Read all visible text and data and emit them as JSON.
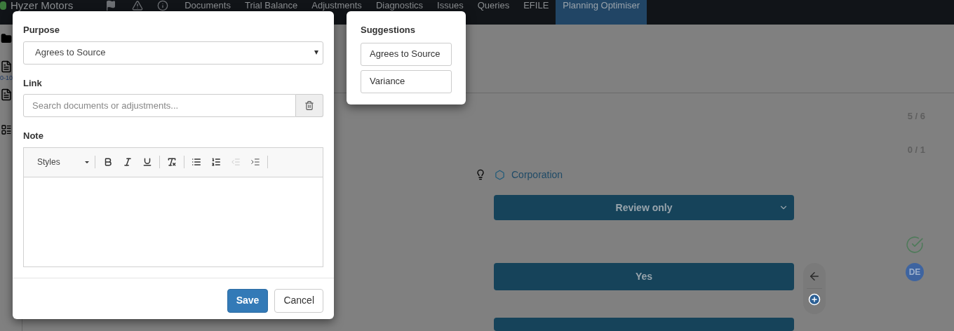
{
  "app": {
    "name": "Hyzer Motors"
  },
  "nav": [
    {
      "label": "Documents",
      "selected": false
    },
    {
      "label": "Trial Balance",
      "selected": false
    },
    {
      "label": "Adjustments",
      "selected": false
    },
    {
      "label": "Diagnostics",
      "selected": false
    },
    {
      "label": "Issues",
      "selected": false
    },
    {
      "label": "Queries",
      "selected": false
    },
    {
      "label": "EFILE",
      "selected": false
    },
    {
      "label": "Planning Optimiser",
      "selected": true
    }
  ],
  "sidebar": {
    "doc_label": "0-10"
  },
  "content": {
    "counts": [
      "5 / 6",
      "0 / 1"
    ],
    "entity": "Corporation",
    "review_select": "Review only",
    "answer_button": "Yes",
    "avatar": "DE",
    "reviewed": true
  },
  "dialog": {
    "purpose": {
      "label": "Purpose",
      "value": "Agrees to Source"
    },
    "link": {
      "label": "Link",
      "placeholder": "Search documents or adjustments..."
    },
    "note": {
      "label": "Note",
      "styles": "Styles",
      "toolbar": [
        {
          "kind": "bold",
          "disabled": false
        },
        {
          "kind": "italic",
          "disabled": false
        },
        {
          "kind": "underline",
          "disabled": false
        },
        {
          "kind": "clear-format",
          "disabled": false
        },
        {
          "kind": "bulleted-list",
          "disabled": false
        },
        {
          "kind": "numbered-list",
          "disabled": false
        },
        {
          "kind": "outdent",
          "disabled": true
        },
        {
          "kind": "indent",
          "disabled": false
        }
      ]
    },
    "buttons": [
      "Save",
      "Cancel"
    ]
  },
  "suggestions": {
    "title": "Suggestions",
    "items": [
      "Agrees to Source",
      "Variance"
    ]
  }
}
